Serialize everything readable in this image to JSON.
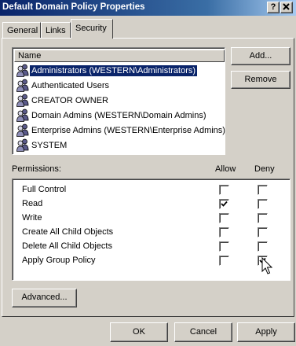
{
  "window": {
    "title": "Default Domain Policy Properties",
    "help_label": "?",
    "close_label": "✕"
  },
  "tabs": [
    {
      "label": "General",
      "active": false
    },
    {
      "label": "Links",
      "active": false
    },
    {
      "label": "Security",
      "active": true
    }
  ],
  "names": {
    "column_header": "Name",
    "items": [
      {
        "label": "Administrators (WESTERN\\Administrators)",
        "selected": true,
        "icon": "user-group-icon"
      },
      {
        "label": "Authenticated Users",
        "selected": false,
        "icon": "user-group-icon"
      },
      {
        "label": "CREATOR OWNER",
        "selected": false,
        "icon": "user-group-icon"
      },
      {
        "label": "Domain Admins (WESTERN\\Domain Admins)",
        "selected": false,
        "icon": "user-group-icon"
      },
      {
        "label": "Enterprise Admins (WESTERN\\Enterprise Admins)",
        "selected": false,
        "icon": "user-group-icon"
      },
      {
        "label": "SYSTEM",
        "selected": false,
        "icon": "user-group-icon"
      }
    ]
  },
  "buttons": {
    "add": "Add...",
    "remove": "Remove",
    "advanced": "Advanced...",
    "ok": "OK",
    "cancel": "Cancel",
    "apply": "Apply"
  },
  "permissions": {
    "label": "Permissions:",
    "allow_header": "Allow",
    "deny_header": "Deny",
    "items": [
      {
        "label": "Full Control",
        "allow": false,
        "deny": false
      },
      {
        "label": "Read",
        "allow": true,
        "deny": false
      },
      {
        "label": "Write",
        "allow": false,
        "deny": false
      },
      {
        "label": "Create All Child Objects",
        "allow": false,
        "deny": false
      },
      {
        "label": "Delete All Child Objects",
        "allow": false,
        "deny": false
      },
      {
        "label": "Apply Group Policy",
        "allow": false,
        "deny": true
      }
    ]
  },
  "colors": {
    "face": "#d4d0c8",
    "selection": "#0a246a",
    "title_gradient_start": "#0a246a",
    "title_gradient_end": "#a6caf0"
  }
}
